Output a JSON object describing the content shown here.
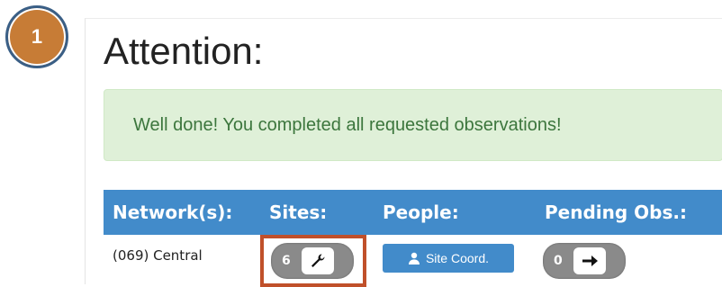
{
  "step_badge": "1",
  "page_title": "Attention:",
  "alert": {
    "message": "Well done! You completed all requested observations!",
    "color": "#dff0d8"
  },
  "table": {
    "header_color": "#428bca",
    "headers": [
      "Network(s):",
      "Sites:",
      "People:",
      "Pending Obs.:"
    ],
    "rows": [
      {
        "network": "(069) Central",
        "sites_count": "6",
        "sites_icon": "wrench-icon",
        "people_button": "Site Coord.",
        "people_icon": "person-icon",
        "pending_count": "0",
        "pending_icon": "arrow-right-icon"
      }
    ]
  },
  "highlight_color": "#c0502a"
}
